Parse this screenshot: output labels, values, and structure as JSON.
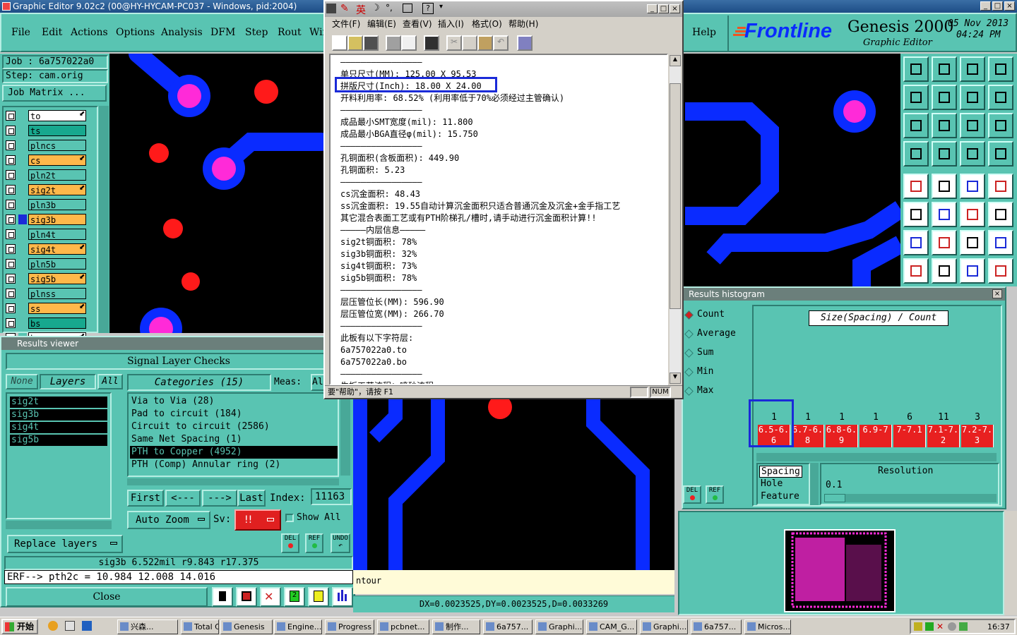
{
  "app": {
    "title": "Graphic Editor 9.02c2 (00@HY-HYCAM-PC037 - Windows, pid:2004)",
    "brand": "Frontline",
    "product": "Genesis 2000",
    "subtitle": "Graphic Editor",
    "date": "05 Nov 2013",
    "time": "04:24 PM"
  },
  "menu": [
    "File",
    "Edit",
    "Actions",
    "Options",
    "Analysis",
    "DFM",
    "Step",
    "Rout",
    "Wir"
  ],
  "help": "Help",
  "job": {
    "job_label": "Job  : 6a757022a0",
    "step_label": "Step: cam.orig",
    "matrix_button": "Job Matrix ..."
  },
  "layers": [
    {
      "name": "to",
      "color": "#ffffff",
      "arrow": true
    },
    {
      "name": "ts",
      "color": "#17a88e",
      "arrow": false
    },
    {
      "name": "plncs",
      "color": "#59c4b2",
      "arrow": false
    },
    {
      "name": "cs",
      "color": "#ffb84a",
      "arrow": true
    },
    {
      "name": "pln2t",
      "color": "#59c4b2",
      "arrow": false
    },
    {
      "name": "sig2t",
      "color": "#ffb84a",
      "arrow": true
    },
    {
      "name": "pln3b",
      "color": "#59c4b2",
      "arrow": false
    },
    {
      "name": "sig3b",
      "color": "#ffb84a",
      "arrow": false
    },
    {
      "name": "pln4t",
      "color": "#59c4b2",
      "arrow": false
    },
    {
      "name": "sig4t",
      "color": "#ffb84a",
      "arrow": true
    },
    {
      "name": "pln5b",
      "color": "#59c4b2",
      "arrow": false
    },
    {
      "name": "sig5b",
      "color": "#ffb84a",
      "arrow": true
    },
    {
      "name": "plnss",
      "color": "#59c4b2",
      "arrow": false
    },
    {
      "name": "ss",
      "color": "#ffb84a",
      "arrow": true
    },
    {
      "name": "bs",
      "color": "#17a88e",
      "arrow": false
    },
    {
      "name": "bo",
      "color": "#ffffff",
      "arrow": true
    }
  ],
  "results_viewer": {
    "title": "Results viewer",
    "header": "Signal Layer Checks",
    "none": "None",
    "layers": "Layers",
    "all": "All",
    "categories_label": "Categories (15)",
    "meas": "Meas:",
    "meas_val": "Al",
    "layer_list": [
      "sig2t",
      "sig3b",
      "sig4t",
      "sig5b"
    ],
    "categories": [
      "Via to Via (28)",
      "Pad to circuit (184)",
      "Circuit to circuit (2586)",
      "Same Net Spacing (1)",
      "PTH to Copper (4952)",
      "PTH (Comp) Annular ring (2)"
    ],
    "first": "First",
    "prev": "<---",
    "next": "--->",
    "last": "Last",
    "index_label": "Index:",
    "index_val": "11163",
    "auto_zoom": "Auto Zoom",
    "sv": "Sv:",
    "sv_val": "!!",
    "show_all": "Show All",
    "replace_layers": "Replace layers",
    "status1": "sig3b 6.522mil   r9.843   r17.375",
    "status2": "ERF--> pth2c = 10.984 12.008 14.016",
    "close": "Close",
    "del": "DEL",
    "ref": "REF",
    "undo": "UNDO"
  },
  "text_window": {
    "menu": [
      "文件(F)",
      "编辑(E)",
      "查看(V)",
      "插入(I)",
      "格式(O)",
      "帮助(H)"
    ],
    "ime": "英",
    "lines": [
      "————————————————",
      "单只尺寸(MM): 125.00 X 95.53",
      "拼版尺寸(Inch): 18.00 X 24.00",
      "开料利用率: 68.52% (利用率低于70%必须经过主管确认)",
      "————————————————",
      "成品最小SMT宽度(mil): 11.800",
      "成品最小BGA直径φ(mil): 15.750",
      "————————————————",
      "孔铜面积(含板面积): 449.90",
      "孔铜面积: 5.23",
      "————————————————",
      "cs沉金面积: 48.43",
      "ss沉金面积: 19.55自动计算沉金面积只适合普通沉金及沉金+金手指工艺",
      "其它混合表面工艺或有PTH阶梯孔/槽时,请手动进行沉金面积计算!!",
      "—————内层信息—————",
      "sig2t铜面积: 78%",
      "sig3b铜面积: 32%",
      "sig4t铜面积: 73%",
      "sig5b铜面积: 78%",
      "————————————————",
      "层压管位长(MM): 596.90",
      "层压管位宽(MM): 266.70",
      "————————————————",
      "此板有以下字符层:",
      "6a757022a0.to",
      "6a757022a0.bo",
      "————————————————",
      "生板工艺流程：喷砂流程"
    ],
    "status": "要\"帮助\"，请按 F1",
    "num": "NUM"
  },
  "histogram": {
    "title": "Results histogram",
    "modes": [
      "Count",
      "Average",
      "Sum",
      "Min",
      "Max"
    ],
    "chart_title": "Size(Spacing) / Count",
    "counts": [
      "1",
      "1",
      "1",
      "1",
      "6",
      "11",
      "3"
    ],
    "bins": [
      "6.5-6.6",
      "6.7-6.8",
      "6.8-6.9",
      "6.9-7",
      "7-7.1",
      "7.1-7.2",
      "7.2-7.3"
    ],
    "types": [
      "Spacing",
      "Hole",
      "Feature"
    ],
    "resolution_label": "Resolution",
    "resolution": "0.1",
    "del": "DEL",
    "ref": "REF"
  },
  "bottom": {
    "contour": "ntour",
    "coords": "DX=0.0023525,DY=0.0023525,D=0.0033269"
  },
  "taskbar": {
    "start": "开始",
    "tasks": [
      "兴森...",
      "Total C...",
      "Genesis",
      "Engine...",
      "Progress",
      "pcbnet...",
      "制作...",
      "6a757...",
      "Graphi...",
      "CAM_G...",
      "Graphi...",
      "6a757...",
      "Micros..."
    ],
    "clock": "16:37"
  },
  "colors": {
    "panel": "#59c4b2",
    "trace": "#0a2bff",
    "pad": "#ff2a2a",
    "via": "#ff2ad8"
  }
}
